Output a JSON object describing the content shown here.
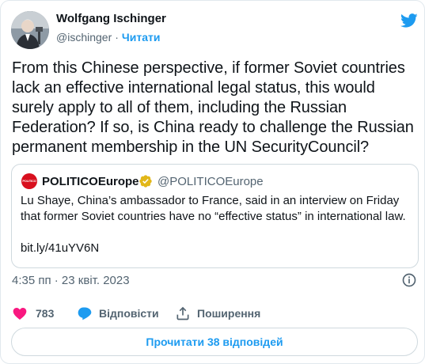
{
  "author": {
    "name": "Wolfgang Ischinger",
    "handle": "@ischinger",
    "separator": "·",
    "follow_label": "Читати"
  },
  "tweet": {
    "text": "From this Chinese perspective, if former Soviet countries lack an effective international legal status, this would surely apply to all of them, including the Russian Federation? If so, is China ready to challenge the Russian permanent membership in the UN SecurityCouncil?",
    "timestamp": "4:35 пп · 23 квіт. 2023"
  },
  "quoted": {
    "logo_text": "POLITICO",
    "name": "POLITICOEurope",
    "handle": "@POLITICOEurope",
    "text": "Lu Shaye, China’s ambassador to France, said in an interview on Friday that former Soviet countries have no “effective status” in international law.",
    "link": "bit.ly/41uYV6N"
  },
  "actions": {
    "like_count": "783",
    "reply_label": "Відповісти",
    "share_label": "Поширення"
  },
  "read_replies_label": "Прочитати 38 відповідей",
  "colors": {
    "accent": "#1d9bf0",
    "like": "#f91880",
    "politico_red": "#d8101e",
    "verified_gold": "#e2b719",
    "muted_text": "#536471"
  },
  "icons": [
    "twitter-bird-icon",
    "verified-badge-icon",
    "info-icon",
    "heart-icon",
    "reply-bubble-icon",
    "share-icon"
  ]
}
